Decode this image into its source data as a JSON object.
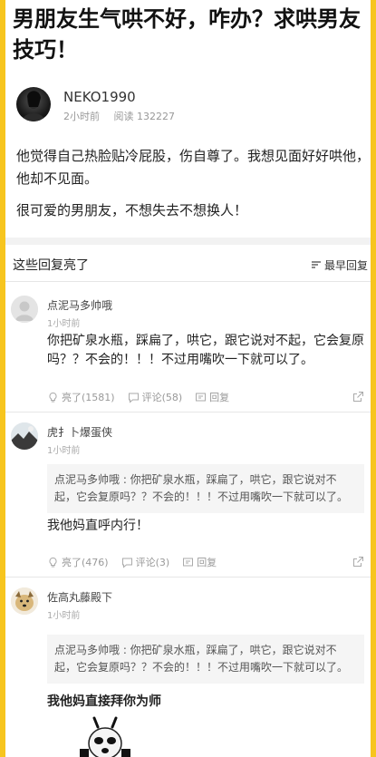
{
  "post": {
    "title": "男朋友生气哄不好，咋办？求哄男友技巧！",
    "author": "NEKO1990",
    "time": "2小时前",
    "reads": "阅读 132227",
    "body": [
      "他觉得自己热脸贴冷屁股，伤自尊了。我想见面好好哄他，他却不见面。",
      "很可爱的男朋友，不想失去不想换人！"
    ]
  },
  "comments_section": {
    "title": "这些回复亮了",
    "sort_label": "最早回复"
  },
  "comments": [
    {
      "name": "点泥马多帅哦",
      "time": "1小时前",
      "text": "你把矿泉水瓶，踩扁了，哄它，跟它说对不起，它会复原吗？？不会的！！！不过用嘴吹一下就可以了。",
      "likes": "亮了(1581)",
      "reviews": "评论(58)",
      "reply": "回复"
    },
    {
      "name": "虎扌卜爆蛋侠",
      "time": "1小时前",
      "quote": "点泥马多帅哦 : 你把矿泉水瓶，踩扁了，哄它，跟它说对不起，它会复原吗？？不会的！！！不过用嘴吹一下就可以了。",
      "text": "我他妈直呼内行！",
      "likes": "亮了(476)",
      "reviews": "评论(3)",
      "reply": "回复"
    },
    {
      "name": "佐高丸藤殿下",
      "time": "1小时前",
      "quote": "点泥马多帅哦 : 你把矿泉水瓶，踩扁了，哄它，跟它说对不起，它会复原吗？？不会的！！！不过用嘴吹一下就可以了。",
      "text": "我他妈直接拜你为师"
    }
  ],
  "colors": {
    "border": "#f7c51e",
    "text": "#222222",
    "muted": "#999999",
    "quote_bg": "#f5f5f5"
  }
}
